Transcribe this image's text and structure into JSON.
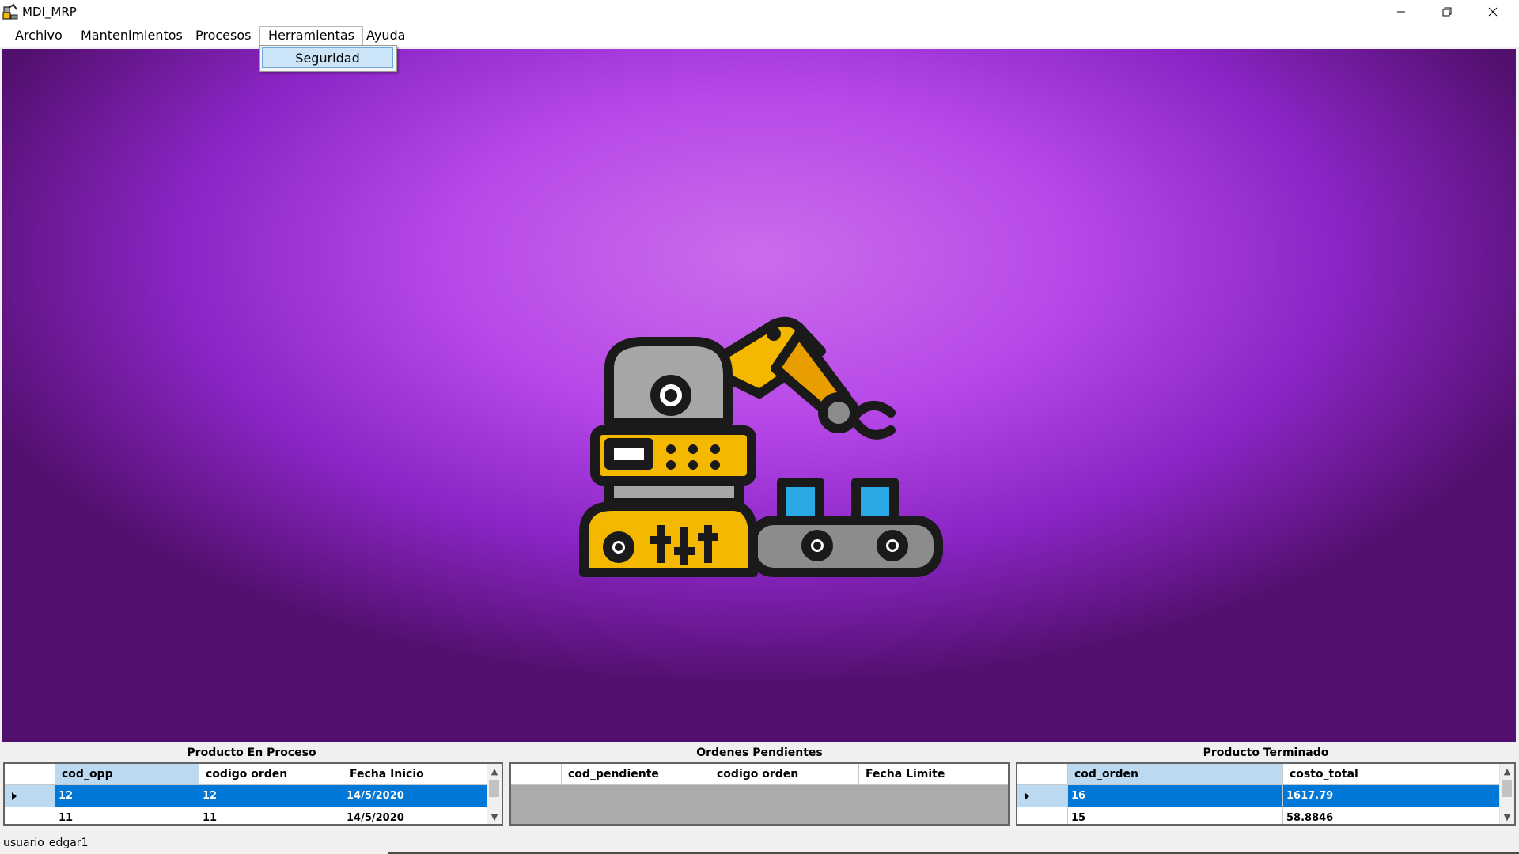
{
  "window": {
    "title": "MDI_MRP"
  },
  "menu": {
    "items": [
      {
        "label": "Archivo"
      },
      {
        "label": "Mantenimientos"
      },
      {
        "label": "Procesos"
      },
      {
        "label": "Herramientas"
      },
      {
        "label": "Ayuda"
      }
    ],
    "open_item": "Herramientas",
    "dropdown": [
      {
        "label": "Seguridad"
      }
    ]
  },
  "background": {
    "image": "robot-arm-conveyor-illustration",
    "colors": {
      "center": "#cc6cec",
      "edge": "#52106e"
    }
  },
  "grids": {
    "proceso": {
      "title": "Producto En Proceso",
      "columns": [
        "cod_opp",
        "codigo orden",
        "Fecha Inicio"
      ],
      "rows": [
        [
          "12",
          "12",
          "14/5/2020"
        ],
        [
          "11",
          "11",
          "14/5/2020"
        ]
      ]
    },
    "pendientes": {
      "title": "Ordenes Pendientes",
      "columns": [
        "cod_pendiente",
        "codigo orden",
        "Fecha Limite"
      ],
      "rows": []
    },
    "terminado": {
      "title": "Producto Terminado",
      "columns": [
        "cod_orden",
        "costo_total"
      ],
      "rows": [
        [
          "16",
          "1617.79"
        ],
        [
          "15",
          "58.8846"
        ]
      ]
    }
  },
  "status": {
    "label": "usuario",
    "value": "edgar1"
  },
  "colors": {
    "selection": "#0078d7",
    "header_selected": "#bcd9f2",
    "accent": "#f5b800"
  }
}
